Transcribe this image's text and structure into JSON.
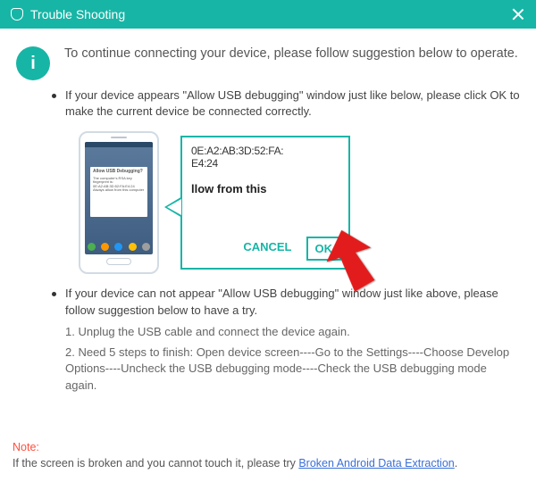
{
  "titlebar": {
    "title": "Trouble Shooting"
  },
  "info_glyph": "i",
  "intro": "To continue connecting your device, please follow suggestion below to operate.",
  "bullet1": "If your device appears \"Allow USB debugging\" window just like below, please click OK to make the current device  be connected correctly.",
  "callout": {
    "mac1": "0E:A2:AB:3D:52:FA:",
    "mac2": "E4:24",
    "mid": "llow from this",
    "cancel": "CANCEL",
    "ok": "OK"
  },
  "phone_dialog": {
    "hdr": "Allow USB Debugging?",
    "body": "The computer's RSA key fingerprint is: 0E:A2:AB:3D:52:FA:E4:24 Always allow from this computer"
  },
  "bullet2": "If your device can not appear \"Allow USB debugging\" window just like above, please follow suggestion below to have a try.",
  "step1": "1. Unplug the USB cable and connect the device again.",
  "step2": "2. Need 5 steps to finish: Open device screen----Go to the Settings----Choose Develop Options----Uncheck the USB debugging mode----Check the USB debugging mode again.",
  "footer": {
    "note_label": "Note:",
    "text": "If the screen is broken and you cannot touch it, please try ",
    "link": "Broken Android Data Extraction",
    "suffix": "."
  }
}
